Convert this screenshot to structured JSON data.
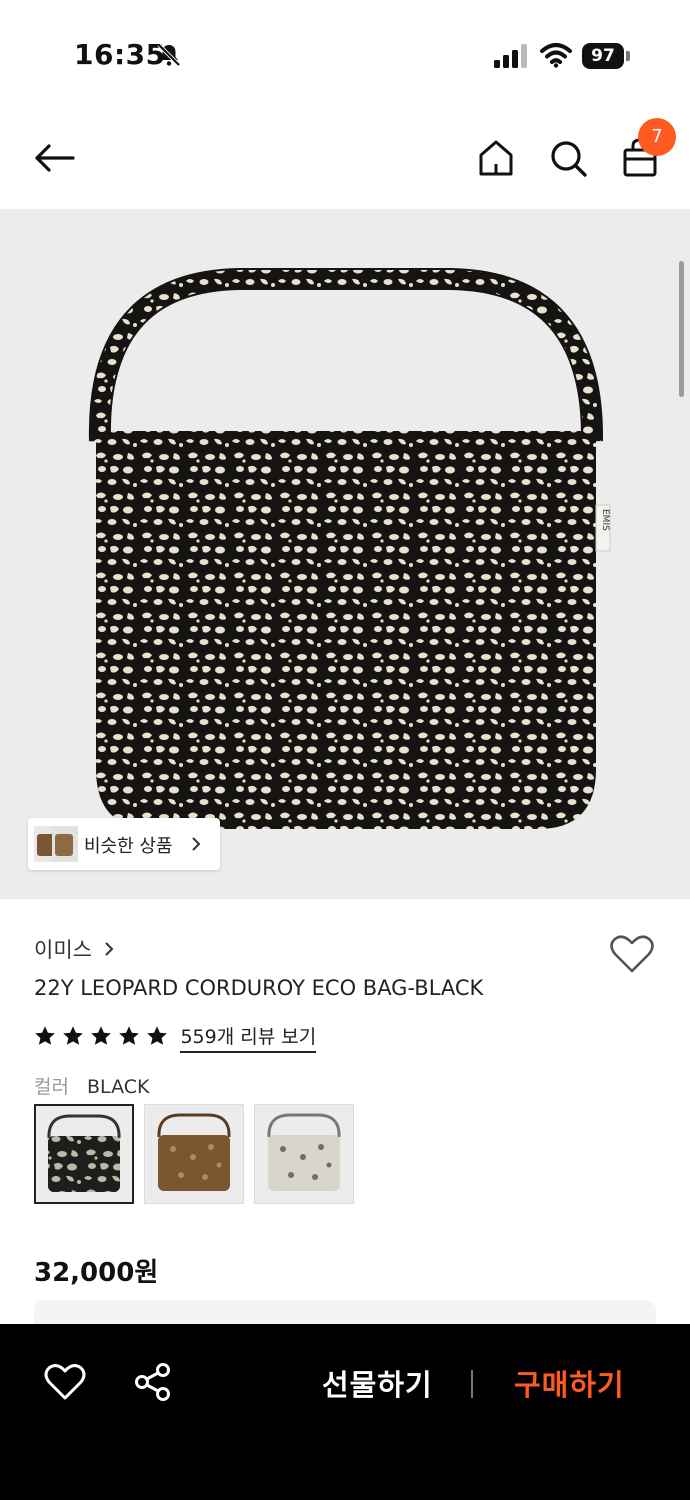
{
  "status_bar": {
    "time": "16:35",
    "battery": "97"
  },
  "nav": {
    "cart_count": "7"
  },
  "hero": {
    "similar_label": "비슷한 상품"
  },
  "product": {
    "brand": "이미스",
    "title": "22Y LEOPARD CORDUROY ECO BAG-BLACK",
    "rating_stars": 5,
    "review_link": "559개 리뷰 보기",
    "color_label": "컬러",
    "color_value": "BLACK",
    "swatches": [
      {
        "name": "black",
        "selected": true
      },
      {
        "name": "brown",
        "selected": false
      },
      {
        "name": "ivory",
        "selected": false
      }
    ],
    "price": "32,000원"
  },
  "bottom_bar": {
    "gift_label": "선물하기",
    "buy_label": "구매하기"
  },
  "colors": {
    "accent": "#ff5a1f",
    "bottom_bg": "#000000",
    "hero_bg": "#ececec"
  }
}
